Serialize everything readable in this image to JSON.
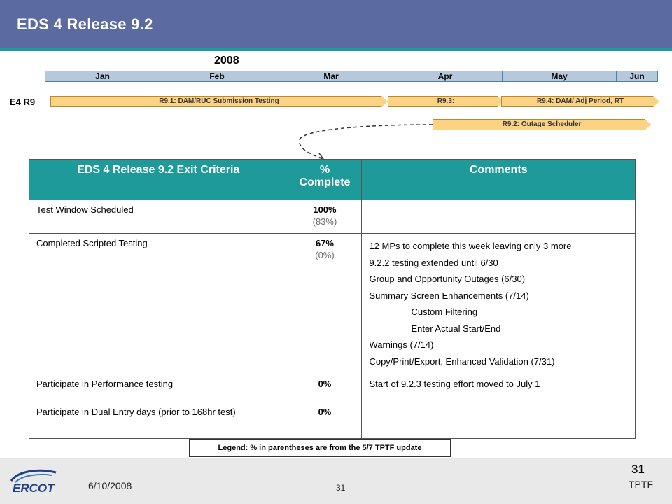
{
  "header": {
    "title": "EDS 4 Release 9.2"
  },
  "timeline": {
    "year": "2008",
    "months": [
      "Jan",
      "Feb",
      "Mar",
      "Apr",
      "May",
      "Jun"
    ],
    "row_label": "E4 R9",
    "bars": {
      "r91": "R9.1: DAM/RUC  Submission Testing",
      "r93": "R9.3:",
      "r94": "R9.4: DAM/ Adj Period, RT",
      "r92": "R9.2: Outage  Scheduler"
    }
  },
  "table": {
    "headers": {
      "criteria": "EDS 4 Release 9.2 Exit Criteria",
      "pct_line1": "%",
      "pct_line2": "Complete",
      "comments": "Comments"
    },
    "rows": [
      {
        "criteria": "Test Window Scheduled",
        "pct": "100%",
        "prev": "(83%)",
        "comments": []
      },
      {
        "criteria": "Completed Scripted Testing",
        "pct": "67%",
        "prev": "(0%)",
        "comments": [
          "12 MPs to complete this week leaving only 3 more",
          "9.2.2 testing extended until 6/30",
          "Group and Opportunity Outages (6/30)",
          "Summary Screen Enhancements (7/14)",
          "Custom Filtering",
          "Enter Actual Start/End",
          "Warnings (7/14)",
          "Copy/Print/Export, Enhanced Validation (7/31)"
        ]
      },
      {
        "criteria": "Participate in Performance testing",
        "pct": "0%",
        "prev": "",
        "comments": [
          "Start of 9.2.3 testing effort moved to July 1"
        ]
      },
      {
        "criteria": "Participate in Dual Entry days (prior to 168hr test)",
        "pct": "0%",
        "prev": "",
        "comments": []
      }
    ]
  },
  "legend": "Legend: % in parentheses are from the 5/7 TPTF update",
  "footer": {
    "logo_text": "ERCOT",
    "date": "6/10/2008",
    "page_center": "31",
    "page_right": "31",
    "org": "TPTF"
  },
  "colors": {
    "header": "#5b6aa0",
    "accent": "#1e9a9a",
    "bar": "#fcd385",
    "month": "#b6c8dc"
  },
  "icons": {
    "logo": "ercot-logo-icon"
  }
}
